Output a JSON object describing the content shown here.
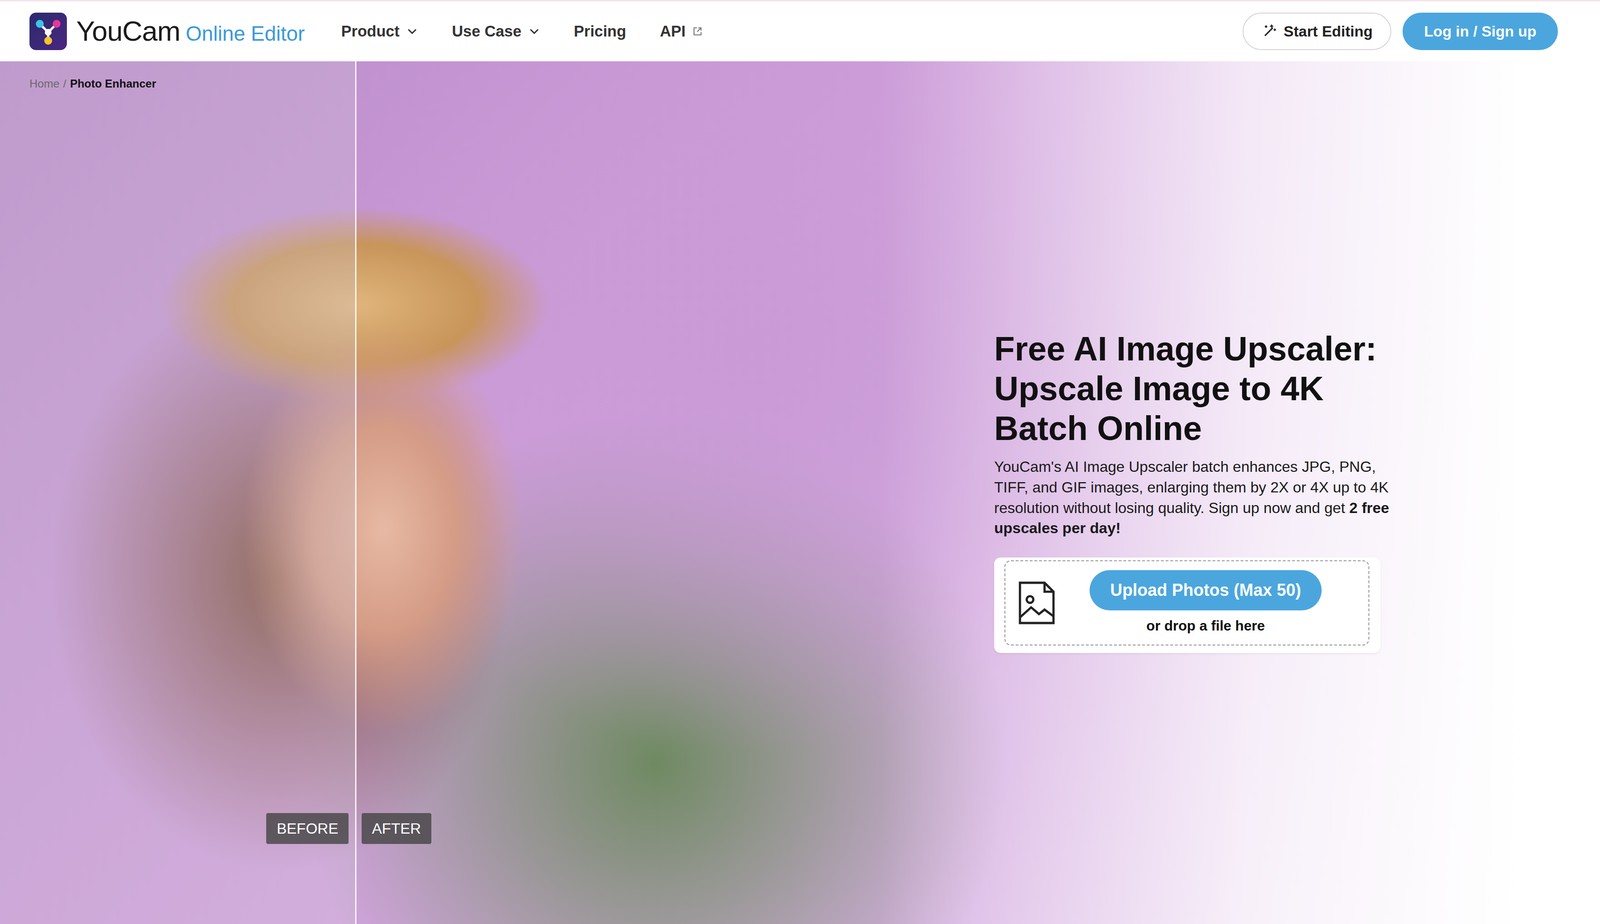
{
  "logo": {
    "brand": "YouCam",
    "product": "Online Editor"
  },
  "nav": [
    {
      "label": "Product",
      "kind": "dropdown"
    },
    {
      "label": "Use Case",
      "kind": "dropdown"
    },
    {
      "label": "Pricing",
      "kind": "link"
    },
    {
      "label": "API",
      "kind": "external"
    }
  ],
  "header_buttons": [
    {
      "label": "Start Editing",
      "kind": "outline"
    },
    {
      "label": "Log in / Sign up",
      "kind": "solid"
    }
  ],
  "breadcrumb": {
    "separator": "/",
    "items": [
      {
        "label": "Home",
        "selected": false
      },
      {
        "label": "Photo Enhancer",
        "selected": true
      }
    ]
  },
  "compare": {
    "level": 0.222,
    "labels": [
      "BEFORE",
      "AFTER"
    ]
  },
  "hero": {
    "title": "Free AI Image Upscaler: Upscale Image to 4K Batch Online",
    "description": [
      {
        "text": "YouCam's AI Image Upscaler batch enhances JPG, PNG, TIFF, and GIF images, enlarging them by 2X or 4X up to 4K resolution without losing quality. Sign up now and get ",
        "kind": "plain"
      },
      {
        "text": "2 free upscales per day!",
        "kind": "bold"
      }
    ]
  },
  "upload": {
    "button": "Upload Photos (Max 50)",
    "hint": "or drop a file here"
  }
}
